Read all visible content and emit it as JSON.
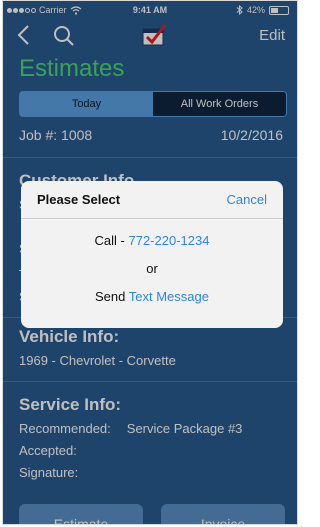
{
  "status_bar": {
    "carrier": "Carrier",
    "time": "9:41 AM",
    "battery": "42%",
    "battery_level": 0.42
  },
  "nav": {
    "edit_label": "Edit",
    "icons": [
      "back-chevron-icon",
      "search-icon",
      "app-logo-icon"
    ]
  },
  "page": {
    "title": "Estimates"
  },
  "segmented": {
    "today_label": "Today",
    "all_label": "All Work Orders"
  },
  "job": {
    "number_label": "Job #: 1008",
    "date": "10/2/2016"
  },
  "customer": {
    "title": "Customer Info"
  },
  "vehicle": {
    "title": "Vehicle Info:",
    "description": "1969 - Chevrolet - Corvette"
  },
  "service": {
    "title": "Service Info:",
    "recommended_label": "Recommended:",
    "recommended_value": "Service Package #3",
    "accepted_label": "Accepted:",
    "signature_label": "Signature:"
  },
  "bottom_buttons": {
    "left_label": "Estimate",
    "right_label": "Invoice"
  },
  "dialog": {
    "title": "Please Select",
    "cancel_label": "Cancel",
    "call_prefix": "Call - ",
    "phone": "772-220-1234",
    "or_label": "or",
    "send_prefix": "Send ",
    "text_message_label": "Text Message"
  },
  "colors": {
    "background": "#2a5b8f",
    "accent_green": "#4fd67a",
    "segment_active": "#5aa0e0",
    "link_blue": "#2e86de",
    "logo_red": "#e02020"
  }
}
